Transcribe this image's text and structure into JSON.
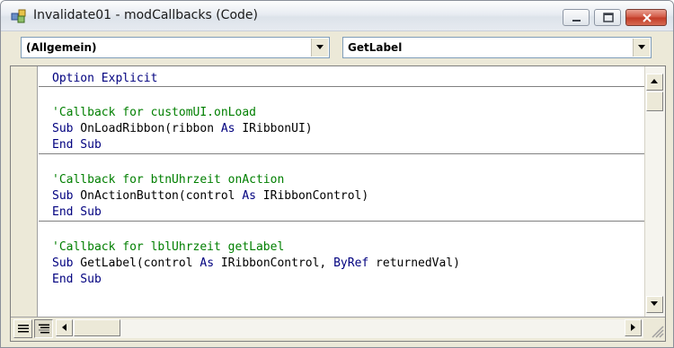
{
  "window": {
    "title": "Invalidate01 - modCallbacks (Code)",
    "app_icon": "vba-module-icon",
    "controls": [
      "minimize-icon",
      "maximize-icon",
      "close-icon"
    ]
  },
  "object_combo": {
    "selected": "(Allgemein)"
  },
  "procedure_combo": {
    "selected": "GetLabel"
  },
  "code": {
    "lines": [
      [
        {
          "t": "Option Explicit",
          "c": "kw"
        }
      ],
      [
        {
          "t": "'Callback for customUI.onLoad",
          "c": "cm"
        }
      ],
      [
        {
          "t": "Sub",
          "c": "kw"
        },
        {
          "t": " OnLoadRibbon(ribbon ",
          "c": ""
        },
        {
          "t": "As",
          "c": "kw"
        },
        {
          "t": " IRibbonUI)",
          "c": ""
        }
      ],
      [
        {
          "t": "End Sub",
          "c": "kw"
        }
      ],
      [
        {
          "t": "'Callback for btnUhrzeit onAction",
          "c": "cm"
        }
      ],
      [
        {
          "t": "Sub",
          "c": "kw"
        },
        {
          "t": " OnActionButton(control ",
          "c": ""
        },
        {
          "t": "As",
          "c": "kw"
        },
        {
          "t": " IRibbonControl)",
          "c": ""
        }
      ],
      [
        {
          "t": "End Sub",
          "c": "kw"
        }
      ],
      [
        {
          "t": "'Callback for lblUhrzeit getLabel",
          "c": "cm"
        }
      ],
      [
        {
          "t": "Sub",
          "c": "kw"
        },
        {
          "t": " GetLabel(control ",
          "c": ""
        },
        {
          "t": "As",
          "c": "kw"
        },
        {
          "t": " IRibbonControl, ",
          "c": ""
        },
        {
          "t": "ByRef",
          "c": "kw"
        },
        {
          "t": " returnedVal)",
          "c": ""
        }
      ],
      [
        {
          "t": "End Sub",
          "c": "kw"
        }
      ]
    ]
  },
  "colors": {
    "keyword": "#00007f",
    "comment": "#007f00",
    "text": "#000000"
  },
  "view_buttons": [
    "procedure-view-icon",
    "full-module-view-icon"
  ]
}
